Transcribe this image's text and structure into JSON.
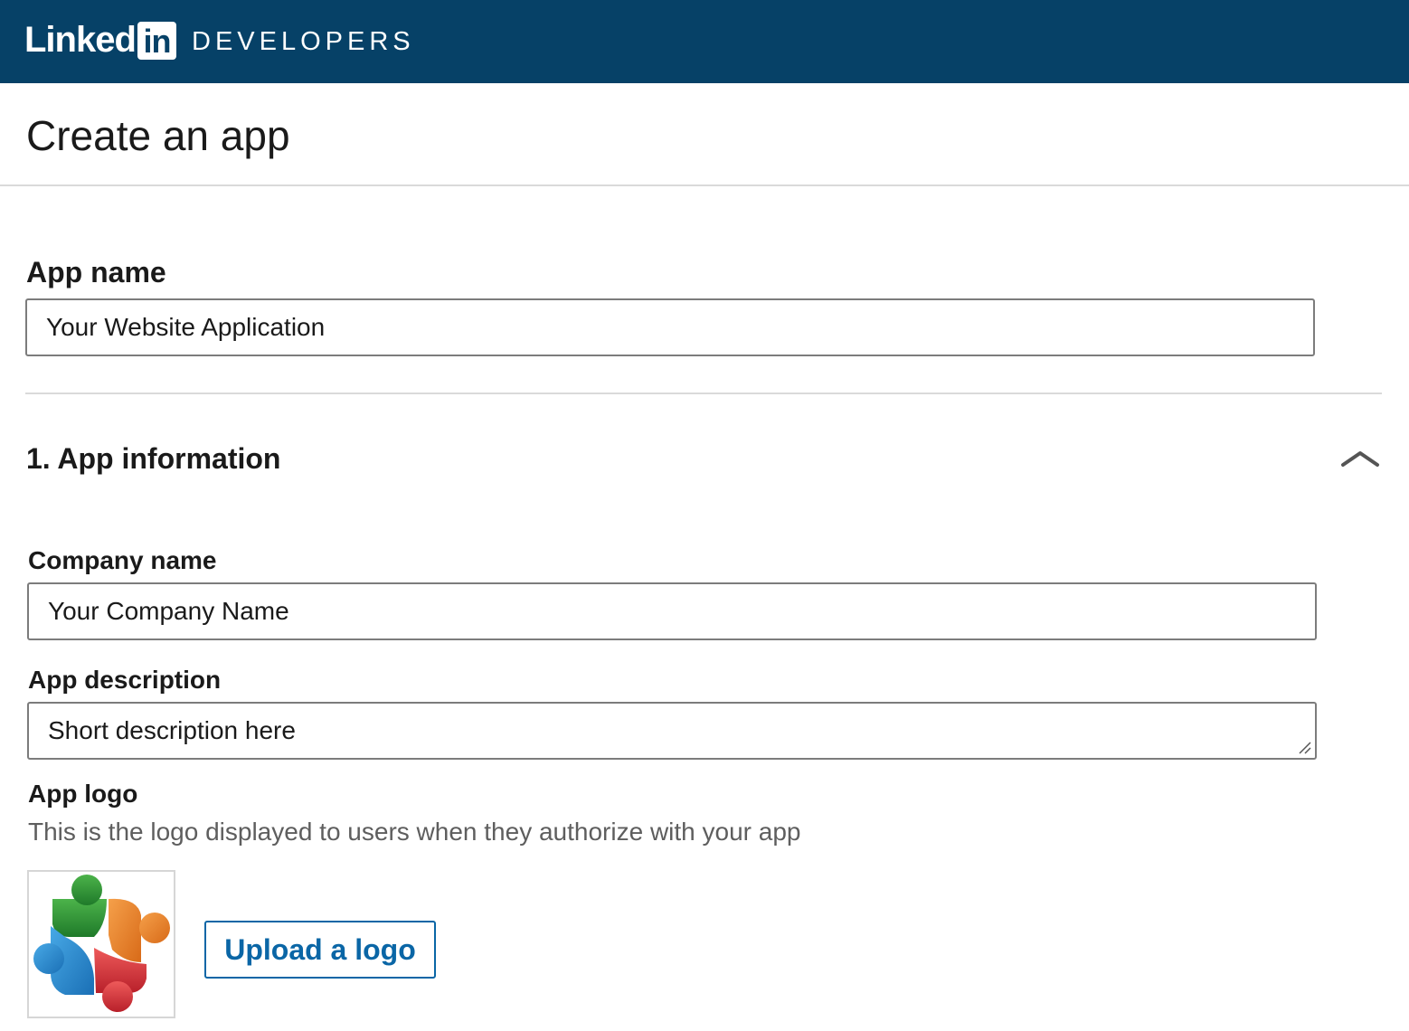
{
  "header": {
    "brand_wordmark": "Linked",
    "brand_badge": "in",
    "brand_product": "DEVELOPERS",
    "background_color": "#064167"
  },
  "page": {
    "title": "Create an app"
  },
  "app_name": {
    "label": "App name",
    "value": "Your Website Application"
  },
  "section": {
    "title": "1. App information",
    "state": "expanded",
    "toggle_icon": "chevron-up-icon"
  },
  "company_name": {
    "label": "Company name",
    "value": "Your Company Name"
  },
  "app_description": {
    "label": "App description",
    "value": "Short description here"
  },
  "app_logo": {
    "label": "App logo",
    "helper": "This is the logo displayed to users when they authorize with your app",
    "image_icon": "team-people-logo",
    "upload_label": "Upload a logo",
    "accent_color": "#0a66a6"
  }
}
